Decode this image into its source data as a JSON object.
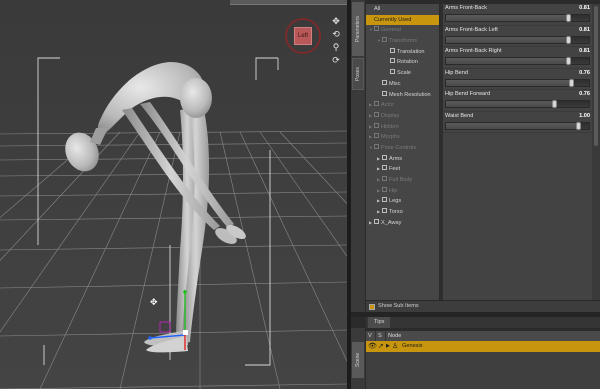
{
  "viewport": {
    "camera_label": "Left",
    "tools": [
      "move-icon",
      "orbit-icon",
      "zoom-icon",
      "frame-icon"
    ]
  },
  "side_tabs": {
    "parameters": "Parameters",
    "second": "Poses",
    "scene": "Scene"
  },
  "tree": [
    {
      "label": "All",
      "depth": 0,
      "arrow": "",
      "icon": false,
      "state": "normal"
    },
    {
      "label": "Currently Used",
      "depth": 0,
      "arrow": "",
      "icon": false,
      "state": "selected"
    },
    {
      "label": "General",
      "depth": 0,
      "arrow": "▼",
      "icon": true,
      "state": "dim"
    },
    {
      "label": "Transforms",
      "depth": 1,
      "arrow": "▼",
      "icon": true,
      "state": "dim"
    },
    {
      "label": "Translation",
      "depth": 2,
      "arrow": "",
      "icon": true,
      "state": "normal"
    },
    {
      "label": "Rotation",
      "depth": 2,
      "arrow": "",
      "icon": true,
      "state": "normal"
    },
    {
      "label": "Scale",
      "depth": 2,
      "arrow": "",
      "icon": true,
      "state": "normal"
    },
    {
      "label": "Misc",
      "depth": 1,
      "arrow": "",
      "icon": true,
      "state": "normal"
    },
    {
      "label": "Mesh Resolution",
      "depth": 1,
      "arrow": "",
      "icon": true,
      "state": "normal"
    },
    {
      "label": "Actor",
      "depth": 0,
      "arrow": "▶",
      "icon": true,
      "state": "dim"
    },
    {
      "label": "Display",
      "depth": 0,
      "arrow": "▶",
      "icon": true,
      "state": "dim"
    },
    {
      "label": "Hidden",
      "depth": 0,
      "arrow": "▶",
      "icon": true,
      "state": "dim"
    },
    {
      "label": "Morphs",
      "depth": 0,
      "arrow": "▶",
      "icon": true,
      "state": "dim"
    },
    {
      "label": "Pose Controls",
      "depth": 0,
      "arrow": "▼",
      "icon": true,
      "state": "dim"
    },
    {
      "label": "Arms",
      "depth": 1,
      "arrow": "▶",
      "icon": true,
      "state": "normal"
    },
    {
      "label": "Feet",
      "depth": 1,
      "arrow": "▶",
      "icon": true,
      "state": "normal"
    },
    {
      "label": "Full Body",
      "depth": 1,
      "arrow": "▶",
      "icon": true,
      "state": "dim"
    },
    {
      "label": "Hip",
      "depth": 1,
      "arrow": "▶",
      "icon": true,
      "state": "dim"
    },
    {
      "label": "Legs",
      "depth": 1,
      "arrow": "▶",
      "icon": true,
      "state": "normal"
    },
    {
      "label": "Torso",
      "depth": 1,
      "arrow": "▶",
      "icon": true,
      "state": "normal"
    },
    {
      "label": "X_Away",
      "depth": 0,
      "arrow": "▶",
      "icon": true,
      "state": "normal"
    }
  ],
  "params": [
    {
      "name": "Arms Front-Back",
      "value": "0.81",
      "fraction": 0.86
    },
    {
      "name": "Arms Front-Back Left",
      "value": "0.81",
      "fraction": 0.86
    },
    {
      "name": "Arms Front-Back Right",
      "value": "0.81",
      "fraction": 0.86
    },
    {
      "name": "Hip Bend",
      "value": "0.76",
      "fraction": 0.88
    },
    {
      "name": "Hip Bend Forward",
      "value": "0.76",
      "fraction": 0.76
    },
    {
      "name": "Waist Bend",
      "value": "1.00",
      "fraction": 0.93
    }
  ],
  "show_sub_items": "Show Sub Items",
  "tips_tab": "Tips",
  "scene": {
    "columns": [
      "V",
      "S",
      "Node"
    ],
    "node_name": "Genesis"
  }
}
